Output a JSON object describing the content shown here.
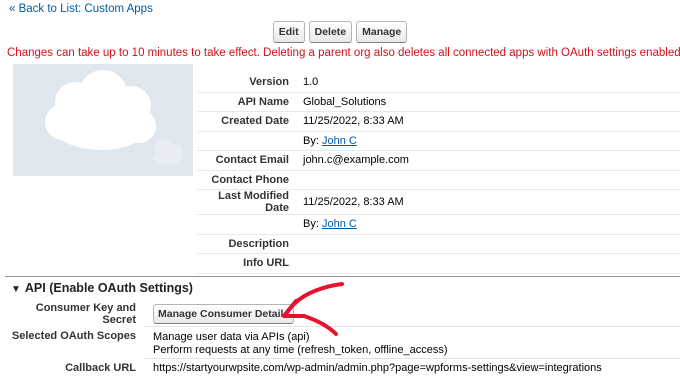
{
  "nav": {
    "back_link": "« Back to List: Custom Apps"
  },
  "toolbar": {
    "edit": "Edit",
    "delete": "Delete",
    "manage": "Manage"
  },
  "warning": "Changes can take up to 10 minutes to take effect. Deleting a parent org also deletes all connected apps with OAuth settings enabled.",
  "details": {
    "version_label": "Version",
    "version": "1.0",
    "api_name_label": "API Name",
    "api_name": "Global_Solutions",
    "created_label": "Created Date",
    "created_date": "11/25/2022, 8:33 AM",
    "by_label": "By:",
    "created_by": "John C",
    "email_label": "Contact Email",
    "email": "john.c@example.com",
    "phone_label": "Contact Phone",
    "phone": "",
    "modified_label": "Last Modified Date",
    "modified_date": "11/25/2022, 8:33 AM",
    "modified_by": "John C",
    "description_label": "Description",
    "description": "",
    "info_url_label": "Info URL",
    "info_url": ""
  },
  "api_section": {
    "title": "API (Enable OAuth Settings)",
    "consumer_label": "Consumer Key and Secret",
    "manage_button": "Manage Consumer Details",
    "scopes_label": "Selected OAuth Scopes",
    "scope_1": "Manage user data via APIs (api)",
    "scope_2": "Perform requests at any time (refresh_token, offline_access)",
    "callback_label": "Callback URL",
    "callback_url": "https://startyourwpsite.com/wp-admin/admin.php?page=wpforms-settings&view=integrations"
  },
  "colors": {
    "link": "#015ba7",
    "warning": "#d4101a",
    "arrow": "#e8102c",
    "logo_bg": "#dfe6ee"
  }
}
